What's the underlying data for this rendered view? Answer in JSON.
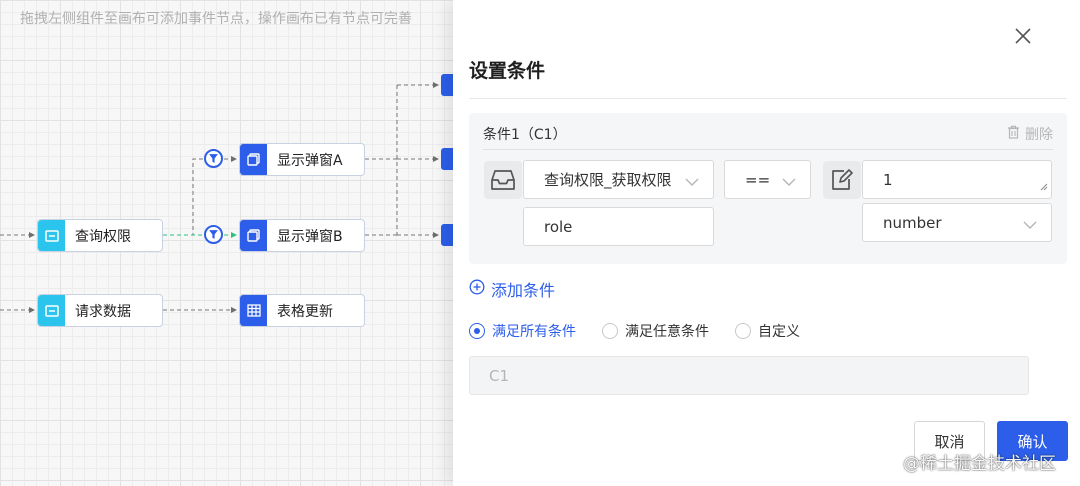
{
  "canvas": {
    "hint": "拖拽左侧组件至画布可添加事件节点，操作画布已有节点可完善",
    "nodes": {
      "query_permission": "查询权限",
      "request_data": "请求数据",
      "show_dialog_a": "显示弹窗A",
      "show_dialog_b": "显示弹窗B",
      "table_update": "表格更新"
    },
    "icons": {
      "event_node": "form-icon",
      "dialog_node": "window-icon",
      "table_node": "table-icon",
      "condition": "filter-icon"
    }
  },
  "panel": {
    "title": "设置条件",
    "condition": {
      "title": "条件1（C1）",
      "delete_label": "删除",
      "source_select": "查询权限_获取权限",
      "source_field": "role",
      "operator": "==",
      "value": "1",
      "value_type": "number"
    },
    "add_condition_label": "添加条件",
    "match_mode": {
      "options": [
        "满足所有条件",
        "满足任意条件",
        "自定义"
      ],
      "selected": "满足所有条件"
    },
    "expression": "C1",
    "cancel_label": "取消",
    "confirm_label": "确认"
  },
  "watermark": "@稀土掘金技术社区",
  "colors": {
    "primary": "#2c5ee9",
    "event_node": "#2bc4ec",
    "edge_active": "#2ec27e"
  }
}
